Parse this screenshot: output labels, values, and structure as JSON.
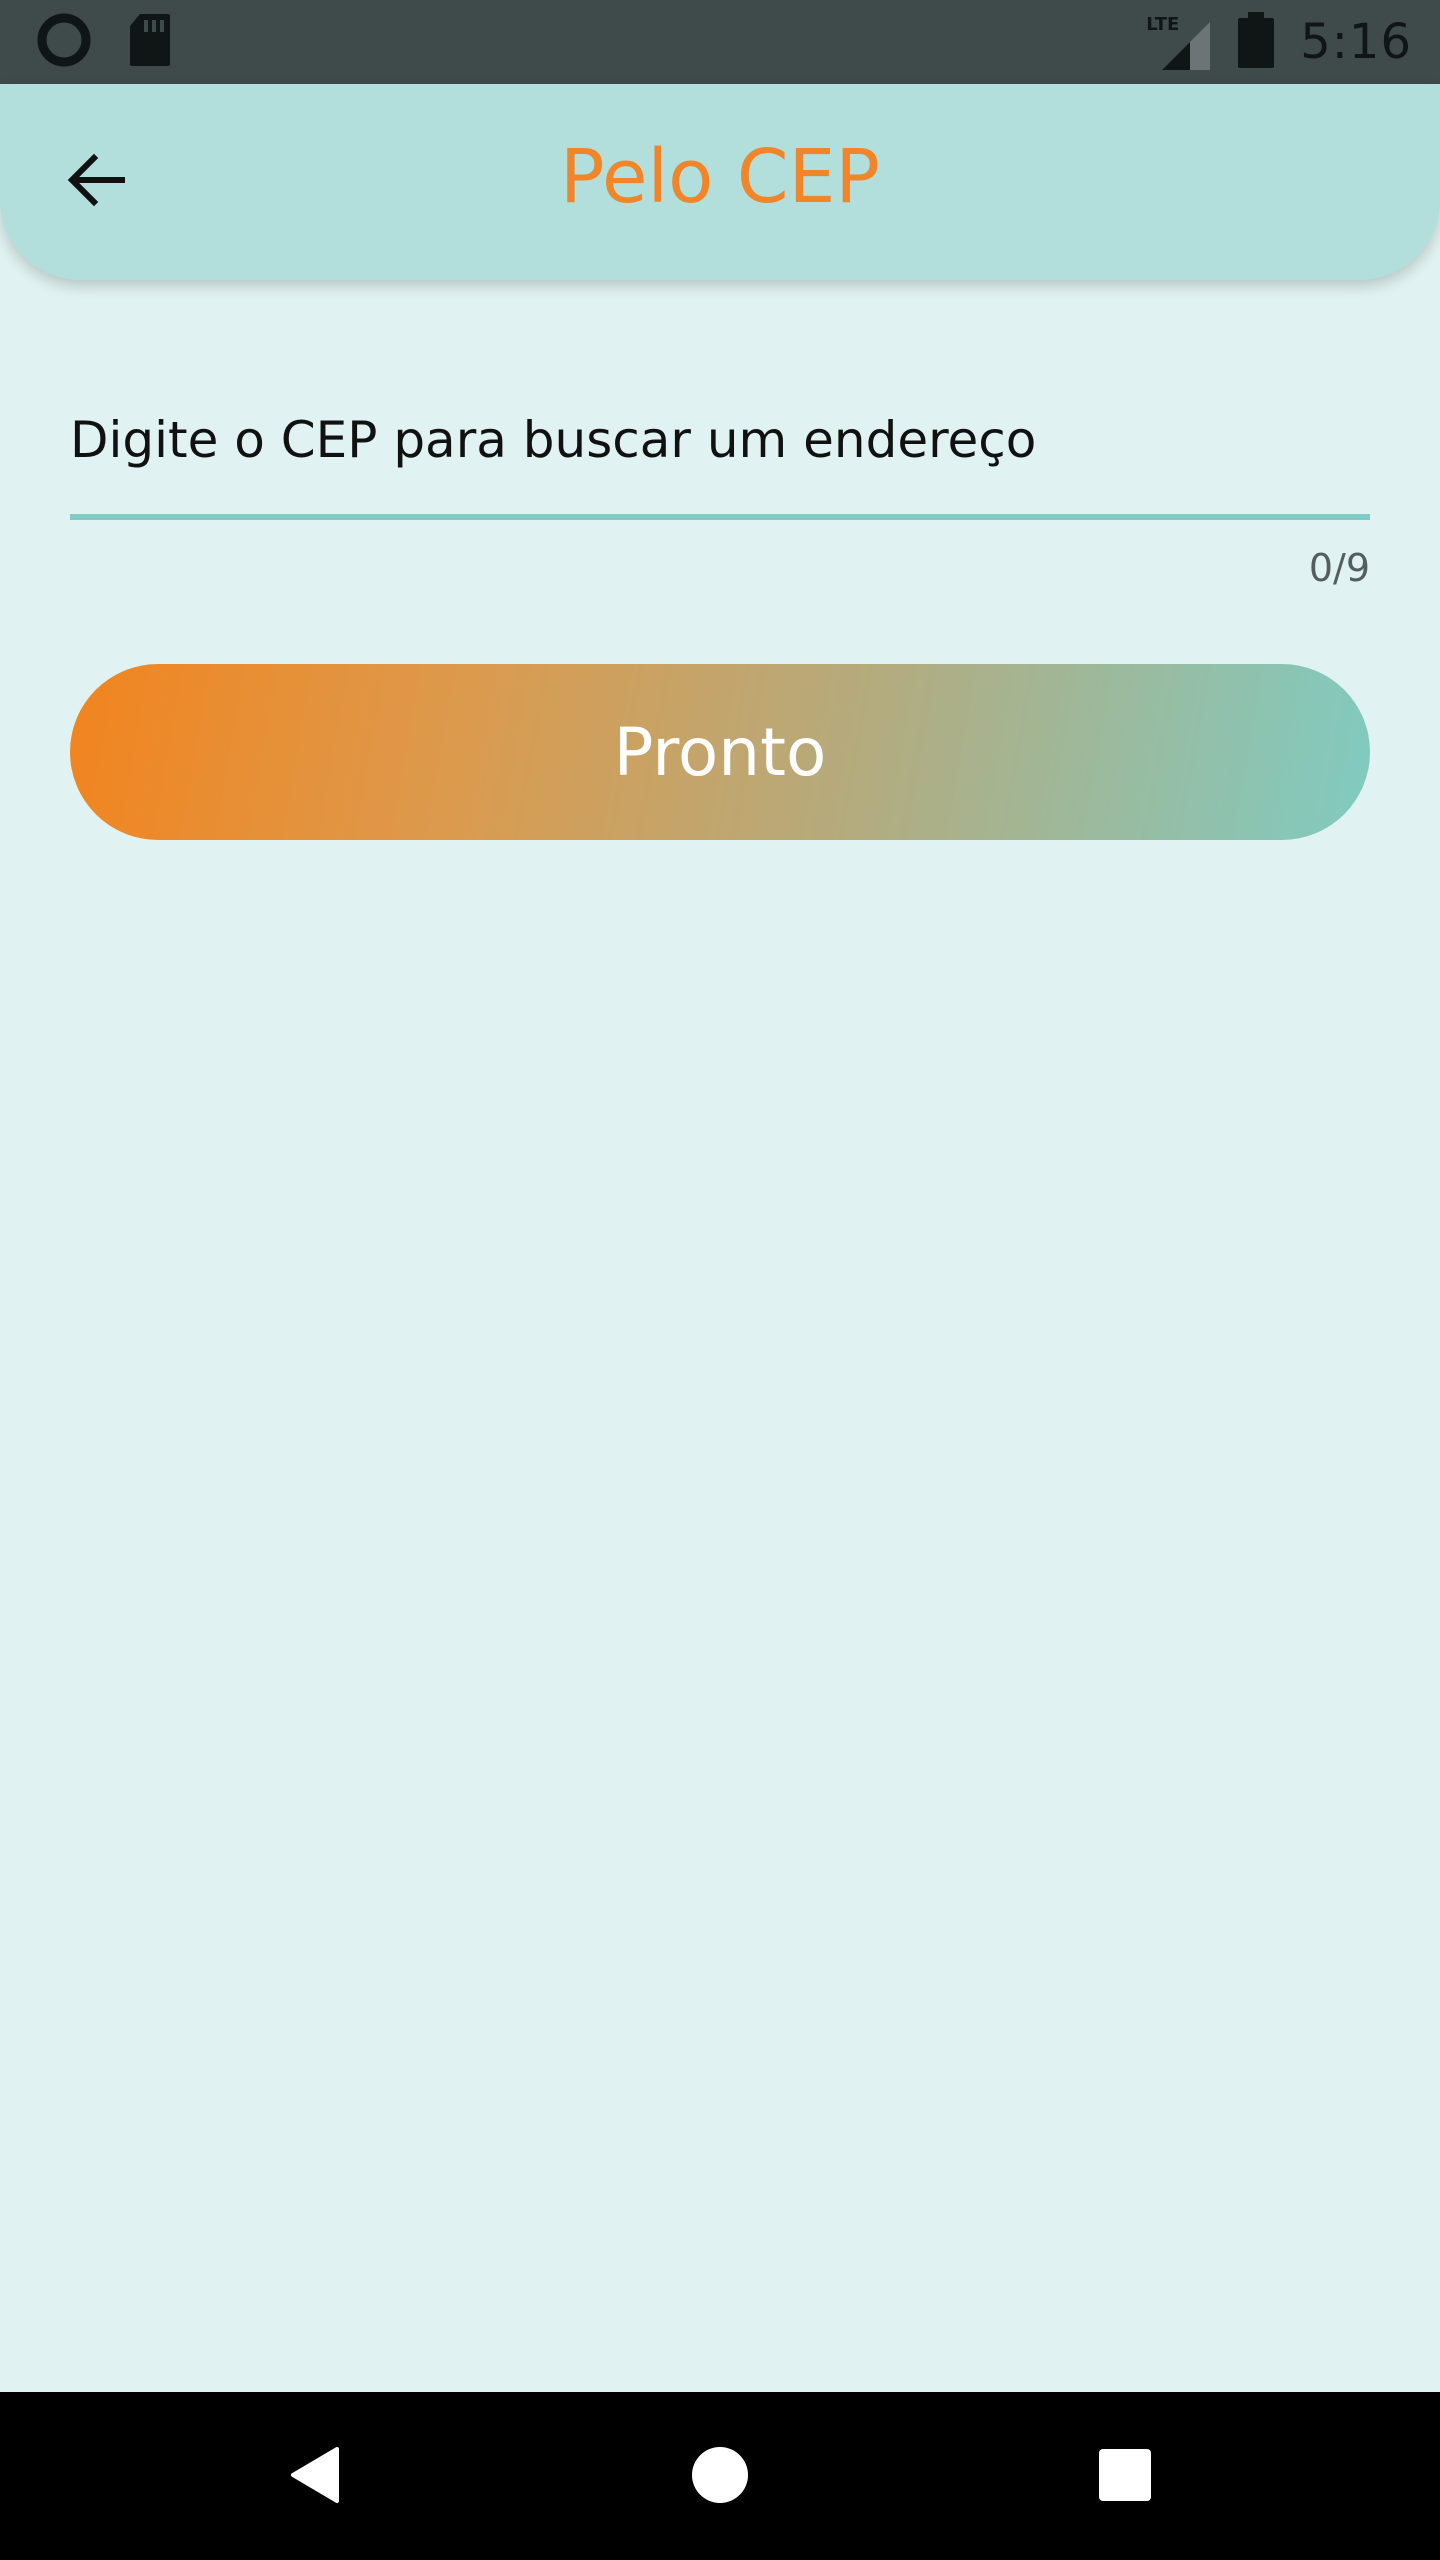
{
  "status_bar": {
    "time": "5:16",
    "network_label": "LTE",
    "icons": [
      "notification-circle-icon",
      "sd-card-icon",
      "lte-signal-icon",
      "battery-icon"
    ]
  },
  "app_bar": {
    "title": "Pelo CEP",
    "back_icon": "arrow-back-icon",
    "title_color": "#f0852a",
    "background_color": "#b2dfdb"
  },
  "form": {
    "cep_placeholder": "Digite o CEP para buscar um endereço",
    "cep_value": "",
    "char_counter": "0/9",
    "submit_label": "Pronto",
    "underline_color": "#80cbc4",
    "button_gradient": [
      "#f2841e",
      "#80cbc1"
    ]
  },
  "nav_bar": {
    "icons": [
      "nav-back-icon",
      "nav-home-icon",
      "nav-recents-icon"
    ]
  },
  "colors": {
    "page_background": "#e0f2f1",
    "status_bar": "#3f4a4a",
    "nav_bar": "#000000"
  }
}
